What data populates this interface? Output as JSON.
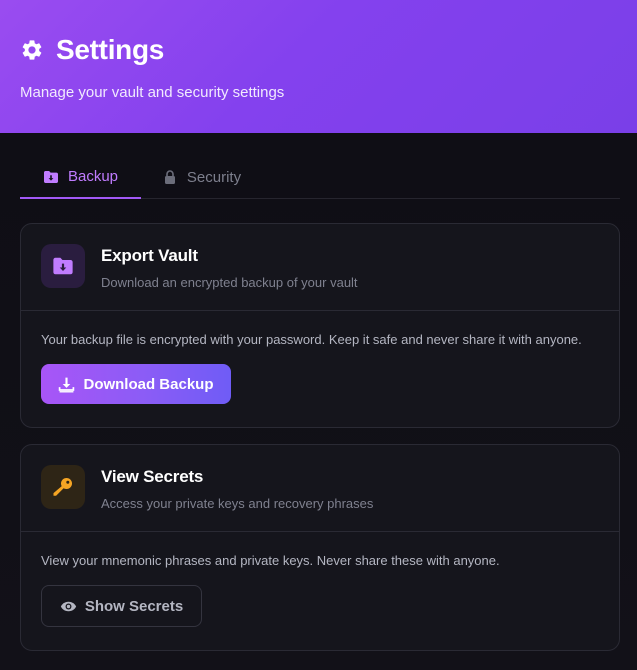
{
  "header": {
    "title": "Settings",
    "subtitle": "Manage your vault and security settings",
    "icon": "gear-icon"
  },
  "tabs": [
    {
      "label": "Backup",
      "icon": "folder-download-icon",
      "active": true
    },
    {
      "label": "Security",
      "icon": "lock-icon",
      "active": false
    }
  ],
  "export_card": {
    "title": "Export Vault",
    "description": "Download an encrypted backup of your vault",
    "body": "Your backup file is encrypted with your password. Keep it safe and never share it with anyone.",
    "button_label": "Download Backup",
    "icon": "folder-download-icon",
    "button_icon": "download-icon"
  },
  "secrets_card": {
    "title": "View Secrets",
    "description": "Access your private keys and recovery phrases",
    "body": "View your mnemonic phrases and private keys. Never share these with anyone.",
    "button_label": "Show Secrets",
    "icon": "key-icon",
    "button_icon": "eye-icon"
  },
  "colors": {
    "accent": "#a259f7",
    "header_gradient_start": "#9a4cf0",
    "header_gradient_end": "#7a3fe8",
    "background": "#121118",
    "card": "#15151c",
    "key_gold": "#f5a524"
  }
}
